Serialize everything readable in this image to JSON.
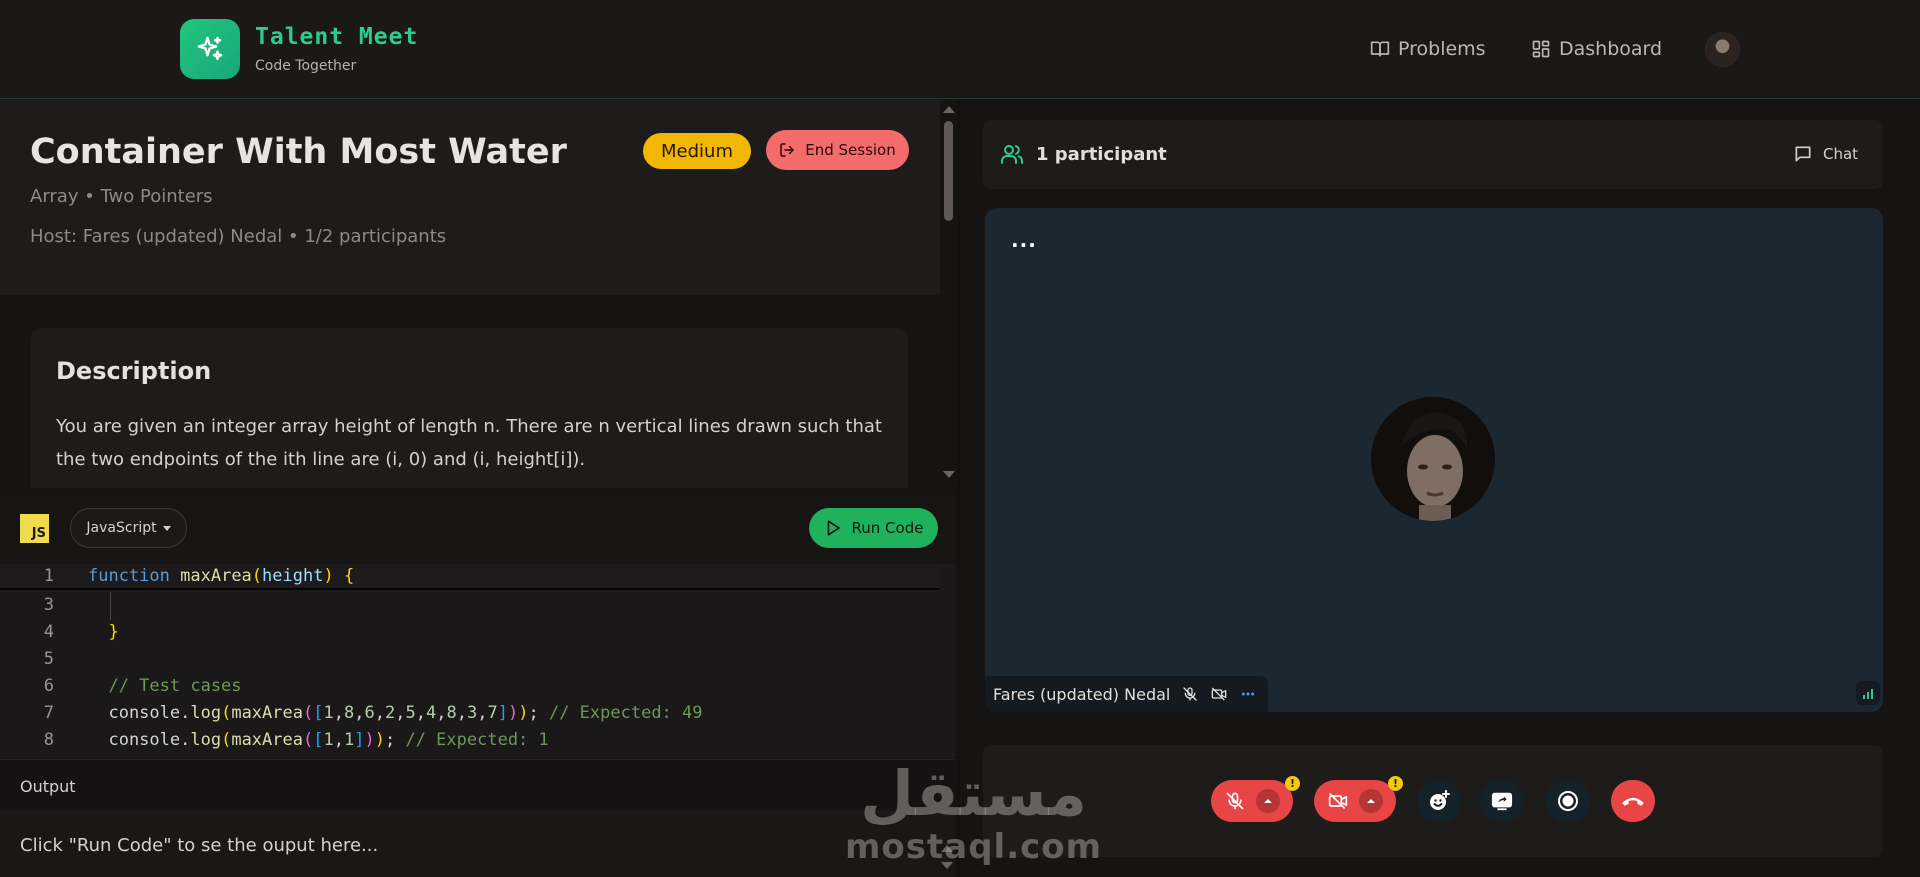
{
  "brand": {
    "title": "Talent Meet",
    "subtitle": "Code Together",
    "accent": "#22c57d"
  },
  "nav": {
    "problems": "Problems",
    "dashboard": "Dashboard"
  },
  "problem": {
    "title": "Container With Most Water",
    "tags": "Array • Two Pointers",
    "host": "Host: Fares (updated) Nedal • 1/2 participants",
    "difficulty": "Medium",
    "end_session": "End Session",
    "description_heading": "Description",
    "description": "You are given an integer array height of length n. There are n vertical lines drawn such that the two endpoints of the ith line are (i, 0) and (i, height[i])."
  },
  "editor": {
    "language_badge": "JS",
    "language": "JavaScript",
    "run_label": "Run Code",
    "lines": [
      {
        "n": "1",
        "code": "function maxArea(height) {"
      },
      {
        "n": "3",
        "code": "  |"
      },
      {
        "n": "4",
        "code": "  }"
      },
      {
        "n": "5",
        "code": ""
      },
      {
        "n": "6",
        "code": "  // Test cases"
      },
      {
        "n": "7",
        "code": "  console.log(maxArea([1,8,6,2,5,4,8,3,7])); // Expected: 49"
      },
      {
        "n": "8",
        "code": "  console.log(maxArea([1,1])); // Expected: 1"
      }
    ]
  },
  "output": {
    "label": "Output",
    "placeholder": "Click \"Run Code\" to se the ouput here..."
  },
  "call": {
    "participants": "1 participant",
    "chat": "Chat",
    "tile_menu": "...",
    "participant_name": "Fares (updated) Nedal",
    "warning": "!"
  },
  "watermark": {
    "arabic": "مستقل",
    "latin": "mostaql.com"
  },
  "colors": {
    "danger": "#e84646",
    "warning": "#f2b704",
    "success": "#1fb15b",
    "tile": "#1b2832"
  }
}
